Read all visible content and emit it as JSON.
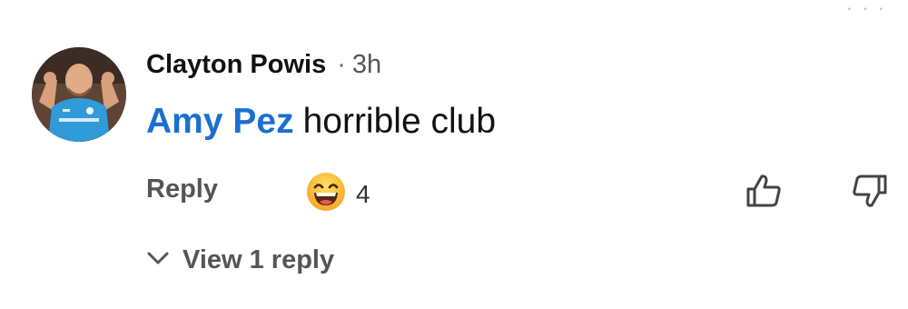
{
  "comment": {
    "author": "Clayton Powis",
    "separator": "·",
    "time": "3h",
    "mention": "Amy Pez",
    "text": "horrible club"
  },
  "actions": {
    "reply_label": "Reply",
    "reaction_icon": "laughing-emoji",
    "reaction_count": "4",
    "like_icon": "thumbs-up-icon",
    "dislike_icon": "thumbs-down-icon"
  },
  "replies": {
    "label": "View 1 reply",
    "icon": "chevron-down-icon"
  },
  "colors": {
    "mention": "#1b6fd1",
    "secondary_text": "#555555"
  }
}
